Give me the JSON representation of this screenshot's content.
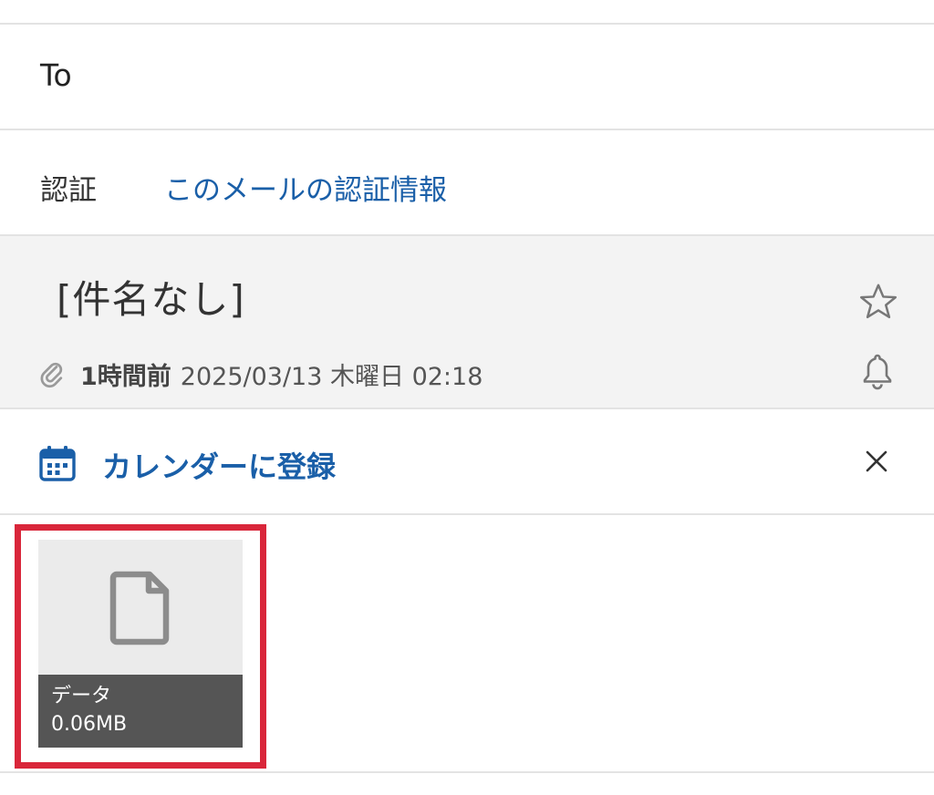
{
  "header": {
    "to_label": "To",
    "auth_label": "認証",
    "auth_link": "このメールの認証情報"
  },
  "message": {
    "subject": "[件名なし]",
    "relative_time": "1時間前",
    "datetime": "2025/03/13 木曜日 02:18",
    "has_attachment": true
  },
  "calendar_banner": {
    "label": "カレンダーに登録",
    "icon": "calendar-icon"
  },
  "attachments": [
    {
      "name": "データ",
      "size": "0.06MB",
      "icon": "file-icon"
    }
  ],
  "colors": {
    "accent": "#1a5fa8",
    "highlight": "#d9263a",
    "subject_bg": "#f3f3f3",
    "caption_bg": "#555555"
  }
}
